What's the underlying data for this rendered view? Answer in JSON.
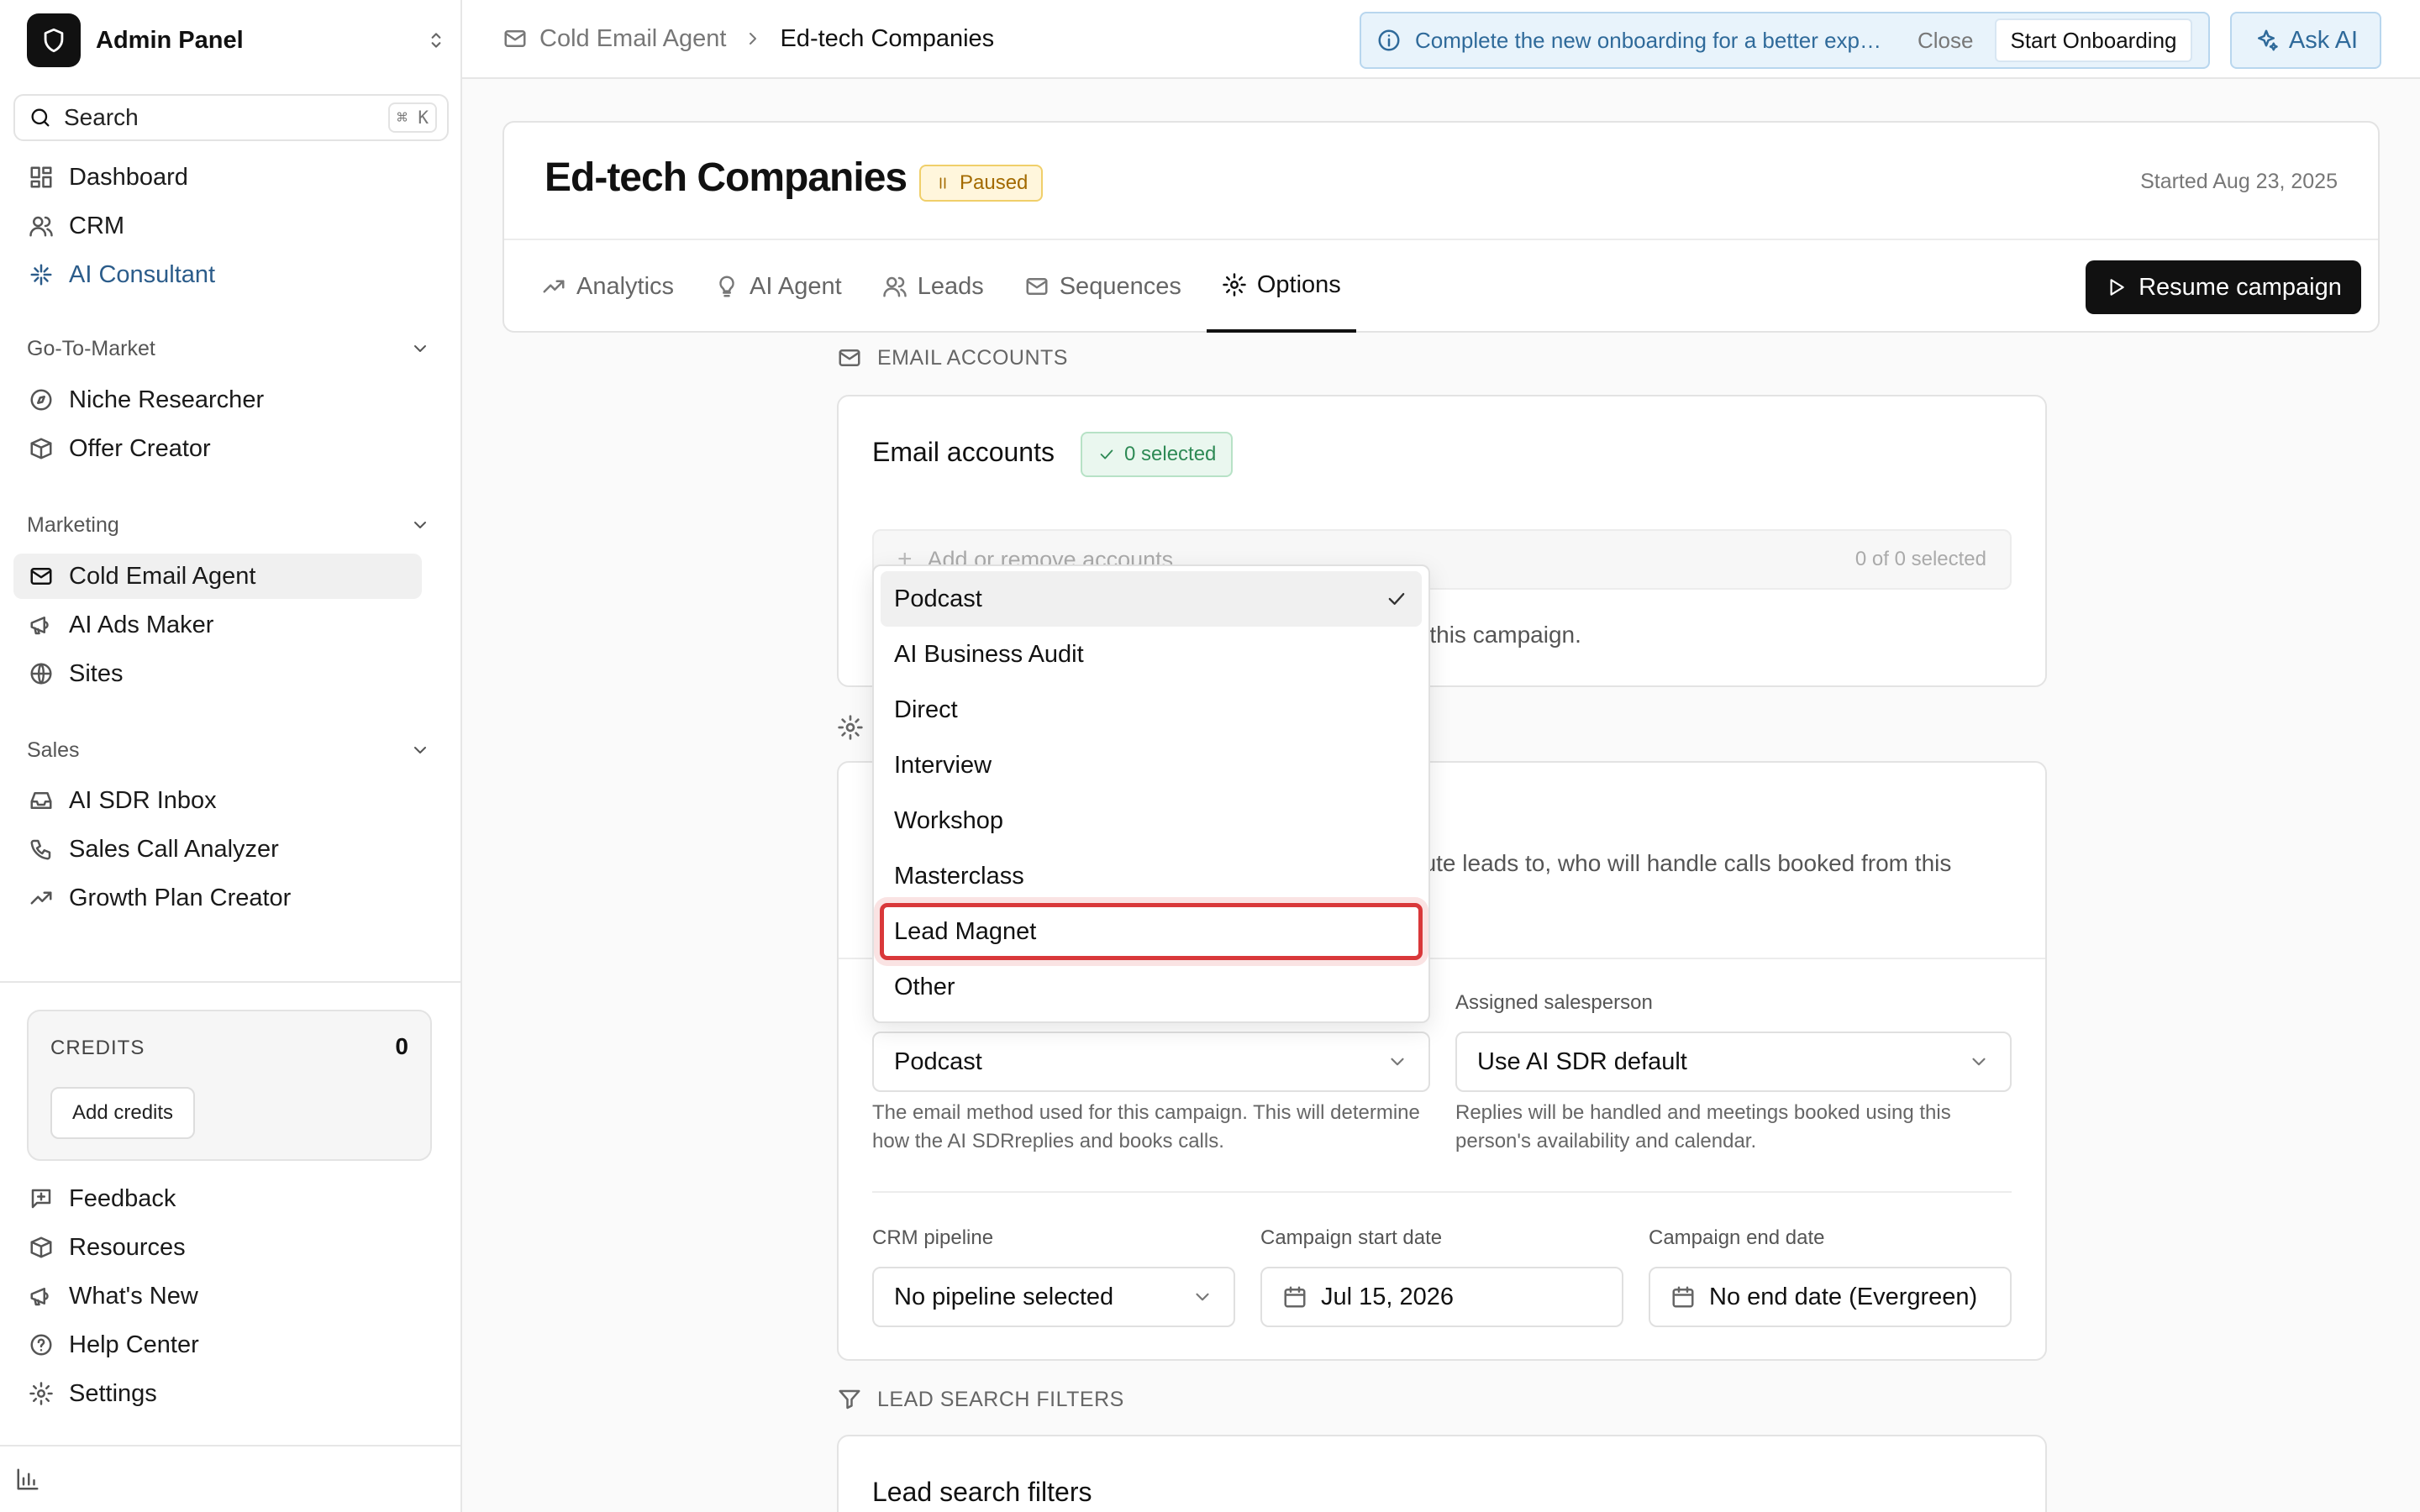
{
  "sidebar": {
    "brand": "Admin Panel",
    "search": {
      "label": "Search",
      "shortcut": "⌘ K"
    },
    "top_items": [
      {
        "label": "Dashboard",
        "icon": "dashboard-icon"
      },
      {
        "label": "CRM",
        "icon": "users-icon"
      },
      {
        "label": "AI Consultant",
        "icon": "sparkle-icon"
      }
    ],
    "sections": [
      {
        "title": "Go-To-Market",
        "items": [
          {
            "label": "Niche Researcher",
            "icon": "compass-icon"
          },
          {
            "label": "Offer Creator",
            "icon": "box-icon"
          }
        ]
      },
      {
        "title": "Marketing",
        "items": [
          {
            "label": "Cold Email Agent",
            "icon": "mail-icon"
          },
          {
            "label": "AI Ads Maker",
            "icon": "megaphone-icon"
          },
          {
            "label": "Sites",
            "icon": "globe-icon"
          }
        ]
      },
      {
        "title": "Sales",
        "items": [
          {
            "label": "AI SDR Inbox",
            "icon": "inbox-icon"
          },
          {
            "label": "Sales Call Analyzer",
            "icon": "phone-icon"
          },
          {
            "label": "Growth Plan Creator",
            "icon": "trending-icon"
          }
        ]
      }
    ],
    "credits": {
      "label": "CREDITS",
      "value": "0",
      "button": "Add credits"
    },
    "footer_items": [
      {
        "label": "Feedback",
        "icon": "feedback-icon"
      },
      {
        "label": "Resources",
        "icon": "box-icon"
      },
      {
        "label": "What's New",
        "icon": "megaphone-icon"
      },
      {
        "label": "Help Center",
        "icon": "help-icon"
      },
      {
        "label": "Settings",
        "icon": "gear-icon"
      }
    ]
  },
  "topbar": {
    "breadcrumb": [
      "Cold Email Agent",
      "Ed-tech Companies"
    ],
    "notice": "Complete the new onboarding for a better experience",
    "notice_close": "Close",
    "notice_start": "Start Onboarding",
    "ask_ai": "Ask AI"
  },
  "campaign": {
    "title": "Ed-tech Companies",
    "status": "Paused",
    "started": "Started Aug 23, 2025",
    "tabs": [
      "Analytics",
      "AI Agent",
      "Leads",
      "Sequences",
      "Options"
    ],
    "active_tab": "Options",
    "resume": "Resume campaign"
  },
  "email_accounts": {
    "section_label": "EMAIL ACCOUNTS",
    "title": "Email accounts",
    "badge": "0 selected",
    "placeholder": "Add or remove accounts",
    "count": "0 of 0 selected",
    "note_tail": "n this campaign."
  },
  "settings": {
    "desc_line1": "oute leads to, who will handle calls booked from this",
    "email_method_value": "Podcast",
    "email_method_help": "The email method used for this campaign. This will determine how the AI SDRreplies and books calls.",
    "salesperson_label": "Assigned salesperson",
    "salesperson_value": "Use AI SDR default",
    "salesperson_help": "Replies will be handled and meetings booked using this person's availability and calendar.",
    "crm_label": "CRM pipeline",
    "crm_value": "No pipeline selected",
    "start_label": "Campaign start date",
    "start_value": "Jul 15, 2026",
    "end_label": "Campaign end date",
    "end_value": "No end date (Evergreen)"
  },
  "lead_filters": {
    "section_label": "LEAD SEARCH FILTERS",
    "title": "Lead search filters"
  },
  "dropdown": {
    "options": [
      "Podcast",
      "AI Business Audit",
      "Direct",
      "Interview",
      "Workshop",
      "Masterclass",
      "Lead Magnet",
      "Other"
    ],
    "selected": "Podcast",
    "highlighted": "Lead Magnet"
  }
}
